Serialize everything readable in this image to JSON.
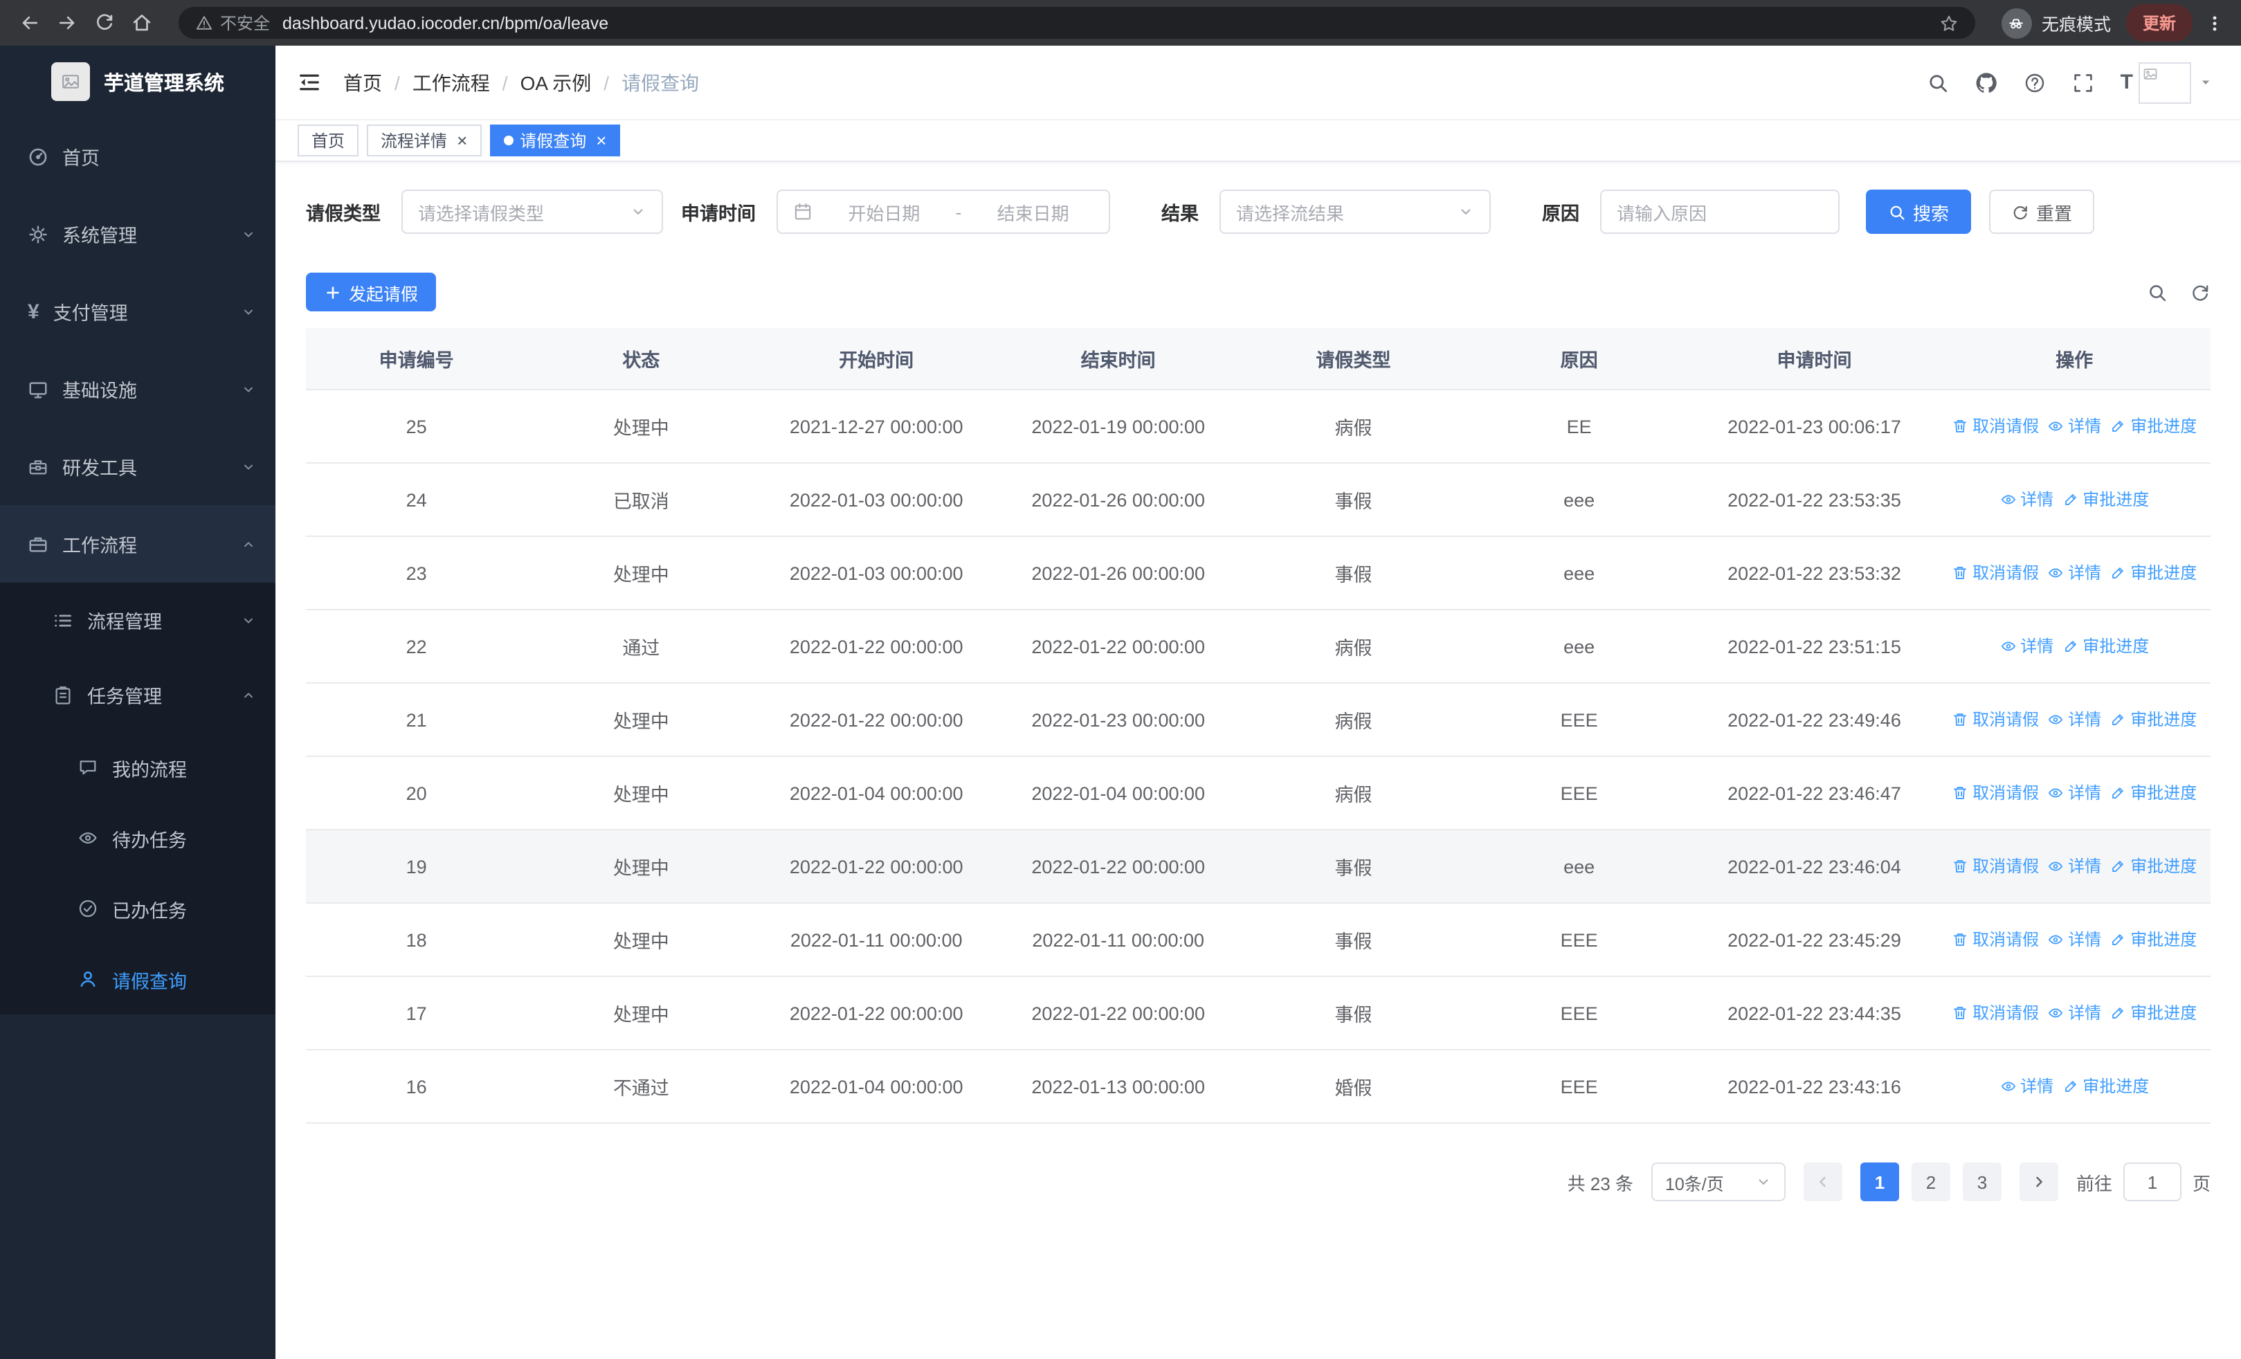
{
  "browser": {
    "nav_icons": [
      "back-icon",
      "forward-icon",
      "reload-icon",
      "home-icon"
    ],
    "security_label": "不安全",
    "url": "dashboard.yudao.iocoder.cn/bpm/oa/leave",
    "incognito_label": "无痕模式",
    "update_label": "更新"
  },
  "sidebar": {
    "logo_title": "芋道管理系统",
    "menu": [
      {
        "name": "home",
        "label": "首页",
        "icon": "dashboard-icon",
        "level": 1
      },
      {
        "name": "system-mgmt",
        "label": "系统管理",
        "icon": "gear-icon",
        "level": 1,
        "chevron": "down"
      },
      {
        "name": "payment-mgmt",
        "label": "支付管理",
        "icon": "yen-icon",
        "level": 1,
        "chevron": "down"
      },
      {
        "name": "infrastructure",
        "label": "基础设施",
        "icon": "monitor-icon",
        "level": 1,
        "chevron": "down"
      },
      {
        "name": "dev-tools",
        "label": "研发工具",
        "icon": "toolbox-icon",
        "level": 1,
        "chevron": "down"
      },
      {
        "name": "workflow",
        "label": "工作流程",
        "icon": "briefcase-icon",
        "level": 1,
        "chevron": "up",
        "open": true
      },
      {
        "name": "process-mgmt",
        "label": "流程管理",
        "icon": "list-icon",
        "level": 2,
        "chevron": "down",
        "sub": true
      },
      {
        "name": "task-mgmt",
        "label": "任务管理",
        "icon": "clipboard-icon",
        "level": 2,
        "chevron": "up",
        "open": true,
        "sub": true
      },
      {
        "name": "my-process",
        "label": "我的流程",
        "icon": "chat-icon",
        "level": 3,
        "sub": true
      },
      {
        "name": "todo-tasks",
        "label": "待办任务",
        "icon": "eye-icon",
        "level": 3,
        "sub": true
      },
      {
        "name": "done-tasks",
        "label": "已办任务",
        "icon": "check-circle-icon",
        "level": 3,
        "sub": true
      },
      {
        "name": "leave-query",
        "label": "请假查询",
        "icon": "user-icon",
        "level": 3,
        "sub": true,
        "active": true
      }
    ]
  },
  "header": {
    "breadcrumb": [
      "首页",
      "工作流程",
      "OA 示例",
      "请假查询"
    ],
    "tools": [
      "search-icon",
      "github-icon",
      "help-icon",
      "fullscreen-icon",
      "fontsize-icon"
    ]
  },
  "tags": [
    {
      "name": "home",
      "label": "首页",
      "closable": false,
      "active": false
    },
    {
      "name": "process-detail",
      "label": "流程详情",
      "closable": true,
      "active": false
    },
    {
      "name": "leave-query",
      "label": "请假查询",
      "closable": true,
      "active": true
    }
  ],
  "filters": {
    "leave_type": {
      "label": "请假类型",
      "placeholder": "请选择请假类型"
    },
    "apply_time": {
      "label": "申请时间",
      "start_placeholder": "开始日期",
      "separator": "-",
      "end_placeholder": "结束日期"
    },
    "result": {
      "label": "结果",
      "placeholder": "请选择流结果"
    },
    "reason": {
      "label": "原因",
      "placeholder": "请输入原因"
    },
    "search_label": "搜索",
    "reset_label": "重置"
  },
  "toolbar": {
    "create_label": "发起请假"
  },
  "table": {
    "columns": [
      "申请编号",
      "状态",
      "开始时间",
      "结束时间",
      "请假类型",
      "原因",
      "申请时间",
      "操作"
    ],
    "action_defs": {
      "cancel": {
        "label": "取消请假",
        "icon": "trash-icon"
      },
      "detail": {
        "label": "详情",
        "icon": "eye-icon"
      },
      "progress": {
        "label": "审批进度",
        "icon": "edit-icon"
      }
    },
    "rows": [
      {
        "id": "25",
        "status": "处理中",
        "start": "2021-12-27 00:00:00",
        "end": "2022-01-19 00:00:00",
        "type": "病假",
        "reason": "EE",
        "apply_time": "2022-01-23 00:06:17",
        "actions": [
          "cancel",
          "detail",
          "progress"
        ]
      },
      {
        "id": "24",
        "status": "已取消",
        "start": "2022-01-03 00:00:00",
        "end": "2022-01-26 00:00:00",
        "type": "事假",
        "reason": "eee",
        "apply_time": "2022-01-22 23:53:35",
        "actions": [
          "detail",
          "progress"
        ]
      },
      {
        "id": "23",
        "status": "处理中",
        "start": "2022-01-03 00:00:00",
        "end": "2022-01-26 00:00:00",
        "type": "事假",
        "reason": "eee",
        "apply_time": "2022-01-22 23:53:32",
        "actions": [
          "cancel",
          "detail",
          "progress"
        ]
      },
      {
        "id": "22",
        "status": "通过",
        "start": "2022-01-22 00:00:00",
        "end": "2022-01-22 00:00:00",
        "type": "病假",
        "reason": "eee",
        "apply_time": "2022-01-22 23:51:15",
        "actions": [
          "detail",
          "progress"
        ]
      },
      {
        "id": "21",
        "status": "处理中",
        "start": "2022-01-22 00:00:00",
        "end": "2022-01-23 00:00:00",
        "type": "病假",
        "reason": "EEE",
        "apply_time": "2022-01-22 23:49:46",
        "actions": [
          "cancel",
          "detail",
          "progress"
        ]
      },
      {
        "id": "20",
        "status": "处理中",
        "start": "2022-01-04 00:00:00",
        "end": "2022-01-04 00:00:00",
        "type": "病假",
        "reason": "EEE",
        "apply_time": "2022-01-22 23:46:47",
        "actions": [
          "cancel",
          "detail",
          "progress"
        ]
      },
      {
        "id": "19",
        "status": "处理中",
        "start": "2022-01-22 00:00:00",
        "end": "2022-01-22 00:00:00",
        "type": "事假",
        "reason": "eee",
        "apply_time": "2022-01-22 23:46:04",
        "actions": [
          "cancel",
          "detail",
          "progress"
        ],
        "highlighted": true
      },
      {
        "id": "18",
        "status": "处理中",
        "start": "2022-01-11 00:00:00",
        "end": "2022-01-11 00:00:00",
        "type": "事假",
        "reason": "EEE",
        "apply_time": "2022-01-22 23:45:29",
        "actions": [
          "cancel",
          "detail",
          "progress"
        ]
      },
      {
        "id": "17",
        "status": "处理中",
        "start": "2022-01-22 00:00:00",
        "end": "2022-01-22 00:00:00",
        "type": "事假",
        "reason": "EEE",
        "apply_time": "2022-01-22 23:44:35",
        "actions": [
          "cancel",
          "detail",
          "progress"
        ]
      },
      {
        "id": "16",
        "status": "不通过",
        "start": "2022-01-04 00:00:00",
        "end": "2022-01-13 00:00:00",
        "type": "婚假",
        "reason": "EEE",
        "apply_time": "2022-01-22 23:43:16",
        "actions": [
          "detail",
          "progress"
        ]
      }
    ]
  },
  "pagination": {
    "total_label": "共 23 条",
    "page_size_label": "10条/页",
    "pages": [
      "1",
      "2",
      "3"
    ],
    "active_page": "1",
    "goto_label": "前往",
    "goto_value": "1",
    "unit_label": "页"
  },
  "colors": {
    "primary": "#3b82f6",
    "link": "#409eff",
    "sidebar_bg": "#1d2634",
    "sidebar_sub_bg": "#151c28"
  }
}
